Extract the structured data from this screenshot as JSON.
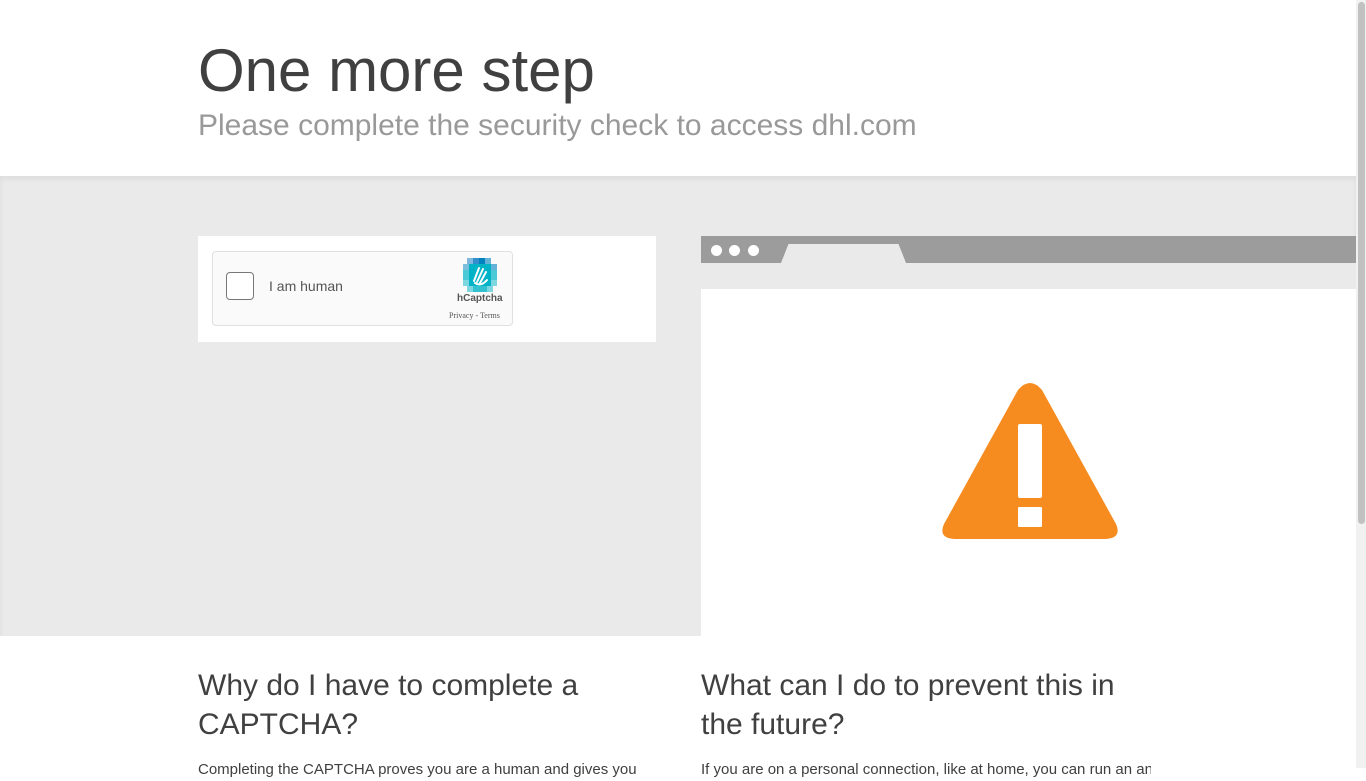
{
  "header": {
    "title": "One more step",
    "subtitle": "Please complete the security check to access dhl.com"
  },
  "captcha": {
    "checkbox_label": "I am human",
    "brand": "hCaptcha",
    "privacy_link": "Privacy",
    "link_separator": "-",
    "terms_link": "Terms"
  },
  "browser_illustration": {
    "warning_color": "#f68b1f",
    "icon": "warning-triangle-icon"
  },
  "info": {
    "why_heading": "Why do I have to complete a CAPTCHA?",
    "why_text": "Completing the CAPTCHA proves you are a human and gives you",
    "prevent_heading": "What can I do to prevent this in the future?",
    "prevent_text": "If you are on a personal connection, like at home, you can run an anti-"
  },
  "colors": {
    "band_background": "#eaeaea",
    "title_color": "#404040",
    "subtitle_color": "#999999",
    "hcaptcha_teal": "#00b3c7"
  }
}
